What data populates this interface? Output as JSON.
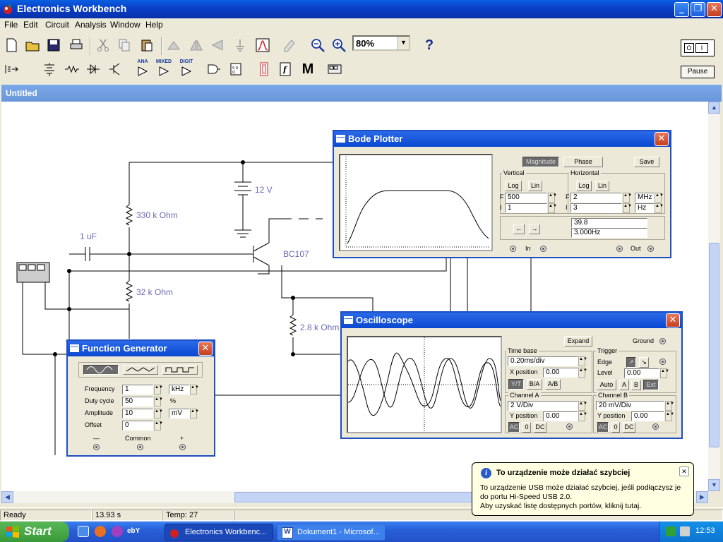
{
  "app": {
    "title": "Electronics Workbench",
    "document_title": "Untitled"
  },
  "menu": [
    "File",
    "Edit",
    "Circuit",
    "Analysis",
    "Window",
    "Help"
  ],
  "toolbar": {
    "zoom_value": "80%",
    "help_label": "?",
    "pause_label": "Pause",
    "power_label": "O I",
    "parts_labels": {
      "ana": "ANA",
      "mixed": "MIXED",
      "digit": "DIGIT",
      "m": "M",
      "f": "f"
    }
  },
  "circuit": {
    "battery": "12 V",
    "r1": "330 k Ohm",
    "r2": "32 k Ohm",
    "r3": "2.8 k Ohm",
    "cap": "1 uF",
    "transistor": "BC107"
  },
  "bode": {
    "title": "Bode Plotter",
    "magnitude": "Magnitude",
    "phase": "Phase",
    "save": "Save",
    "vertical": "Vertical",
    "horizontal": "Horizontal",
    "log": "Log",
    "lin": "Lin",
    "v_f": "500",
    "v_i": "1",
    "h_f": "2",
    "h_i": "3",
    "h_f_unit": "MHz",
    "h_i_unit": "Hz",
    "f_label": "F",
    "i_label": "I",
    "readout_value": "39.8",
    "readout_freq": "3.000Hz",
    "in_label": "In",
    "out_label": "Out"
  },
  "oscilloscope": {
    "title": "Oscilloscope",
    "expand": "Expand",
    "ground": "Ground",
    "timebase": "Time base",
    "timebase_value": "0.20ms/div",
    "x_position": "X position",
    "x_position_value": "0.00",
    "yt": "Y/T",
    "ba": "B/A",
    "ab": "A/B",
    "trigger": "Trigger",
    "edge": "Edge",
    "level": "Level",
    "level_value": "0.00",
    "auto": "Auto",
    "a": "A",
    "b": "B",
    "ext": "Ext",
    "channel_a": "Channel A",
    "channel_a_value": "2  V/Div",
    "channel_b": "Channel B",
    "channel_b_value": "20 mV/Div",
    "y_position": "Y position",
    "ya_value": "0.00",
    "yb_value": "0.00",
    "ac": "AC",
    "zero": "0",
    "dc": "DC"
  },
  "function_generator": {
    "title": "Function Generator",
    "frequency_label": "Frequency",
    "frequency_value": "1",
    "frequency_unit": "kHz",
    "duty_label": "Duty cycle",
    "duty_value": "50",
    "duty_unit": "%",
    "amplitude_label": "Amplitude",
    "amplitude_value": "10",
    "amplitude_unit": "mV",
    "offset_label": "Offset",
    "offset_value": "0",
    "minus": "—",
    "common": "Common",
    "plus": "+"
  },
  "status": {
    "ready": "Ready",
    "time": "13.93 s",
    "temp": "Temp:  27"
  },
  "taskbar": {
    "start": "Start",
    "task1": "Electronics Workbenc...",
    "task2": "Dokument1 - Microsof...",
    "clock": "12:53"
  },
  "balloon": {
    "title": "To urządzenie może działać szybciej",
    "line1": "To urządzenie USB może działać szybciej, jeśli podłączysz je",
    "line2": "do portu Hi-Speed USB 2.0.",
    "line3": "Aby uzyskać listę dostępnych portów, kliknij tutaj."
  },
  "colors": {
    "title_bar": "#0a48d0",
    "mdi_title": "#7aa8e8",
    "component_label": "#6a6ab8",
    "window_bg": "#ece9d8"
  }
}
